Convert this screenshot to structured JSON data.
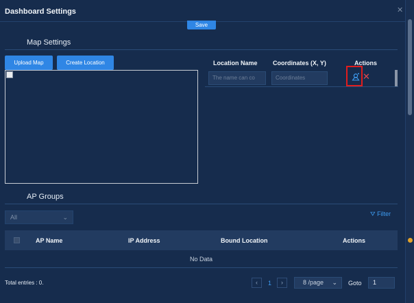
{
  "dialog": {
    "title": "Dashboard Settings",
    "close_icon": "close-icon",
    "save_label": "Save"
  },
  "map_settings": {
    "title": "Map Settings",
    "upload_label": "Upload Map",
    "create_label": "Create Location",
    "locations": {
      "columns": [
        "Location Name",
        "Coordinates (X, Y)",
        "Actions"
      ],
      "rows": [
        {
          "name_placeholder": "The name can contain",
          "name_visible": "The name can co",
          "coords_placeholder": "Coordinates",
          "action_icons": [
            "map-pin-icon",
            "delete-icon"
          ]
        }
      ]
    }
  },
  "ap_groups": {
    "title": "AP Groups",
    "select_value": "All",
    "filter_label": "Filter",
    "columns": [
      "AP Name",
      "IP Address",
      "Bound Location",
      "Actions"
    ],
    "empty_text": "No Data",
    "pagination": {
      "total_text": "Total entries : 0.",
      "current_page": "1",
      "page_size": "8 /page",
      "goto_label": "Goto",
      "goto_value": "1"
    }
  },
  "colors": {
    "background": "#162c4d",
    "accent": "#2f86e5",
    "link": "#3d9bf0",
    "danger": "#e5484d",
    "highlight": "#e11d1d"
  }
}
